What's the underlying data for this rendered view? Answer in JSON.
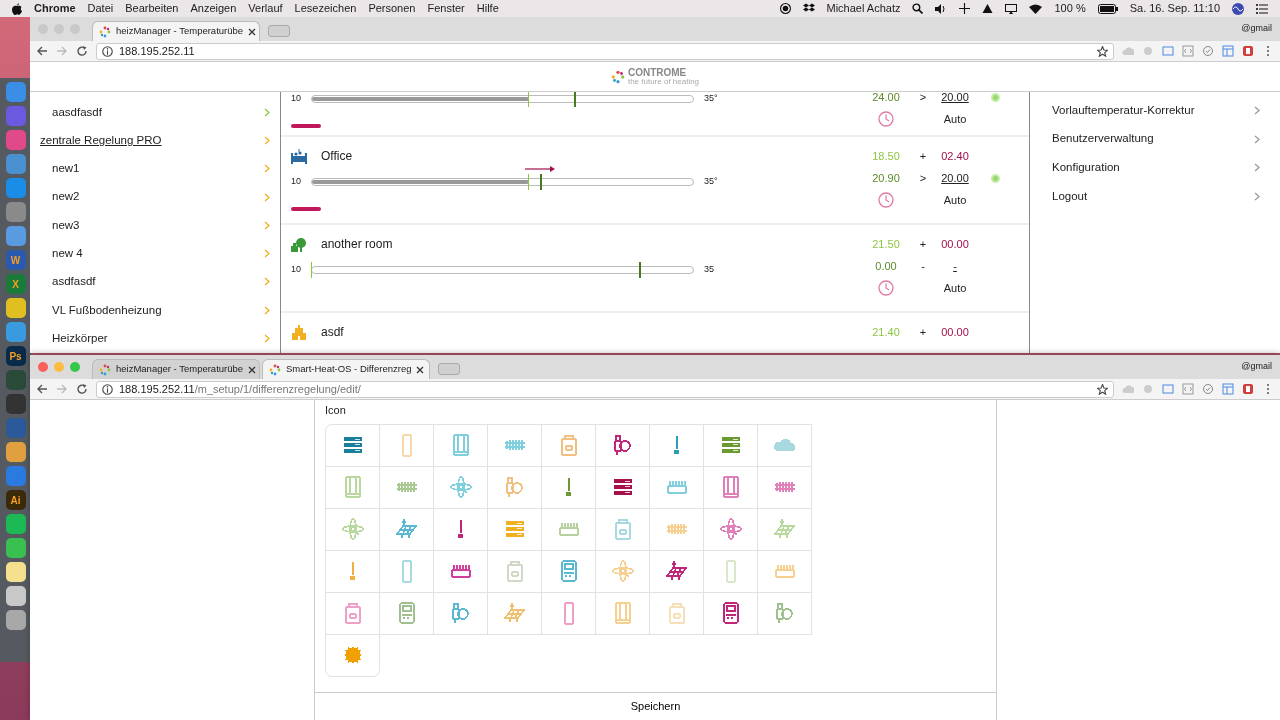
{
  "menubar": {
    "app": "Chrome",
    "menus": [
      "Datei",
      "Bearbeiten",
      "Anzeigen",
      "Verlauf",
      "Lesezeichen",
      "Personen",
      "Fenster",
      "Hilfe"
    ],
    "user": "Michael Achatz",
    "battery": "100 %",
    "clock": "Sa. 16. Sep. 11:10"
  },
  "dock": [
    {
      "color": "#3a8ee6"
    },
    {
      "color": "#6a5ae0"
    },
    {
      "color": "#e04a8a"
    },
    {
      "color": "#4a90d0"
    },
    {
      "color": "#1a8ee6"
    },
    {
      "color": "#8a8a8a"
    },
    {
      "color": "#5a9ae0"
    },
    {
      "color": "#2a5ab0",
      "label": "W"
    },
    {
      "color": "#1a7a3a",
      "label": "X"
    },
    {
      "color": "#e0c020"
    },
    {
      "color": "#3a9ae0"
    },
    {
      "color": "#0a2a4a",
      "label": "Ps"
    },
    {
      "color": "#2a4a3a"
    },
    {
      "color": "#333333"
    },
    {
      "color": "#2a5a9a"
    },
    {
      "color": "#e0a040"
    },
    {
      "color": "#2a7ae0"
    },
    {
      "color": "#3a2a0a",
      "label": "Ai"
    },
    {
      "color": "#1db954"
    },
    {
      "color": "#3ac050"
    },
    {
      "color": "#f5e090"
    },
    {
      "color": "#c8c8c8"
    },
    {
      "color": "#a8a8a8"
    }
  ],
  "window_top": {
    "focused": false,
    "tabs": [
      {
        "title": "heizManager - Temperaturübe",
        "selected": true
      }
    ],
    "profile": "@gmail",
    "url_host": "188.195.252.11",
    "logo": {
      "name": "CONTROME",
      "tagline": "the future of heating"
    },
    "sidebar": [
      {
        "kind": "item",
        "label": "aasdfasdf",
        "color": "#8dc63f"
      },
      {
        "kind": "group",
        "label": "zentrale Regelung PRO",
        "color": "#f0b020"
      },
      {
        "kind": "item",
        "label": "new1",
        "color": "#f0b020"
      },
      {
        "kind": "item",
        "label": "new2",
        "color": "#f0b020"
      },
      {
        "kind": "item",
        "label": "new3",
        "color": "#f0b020"
      },
      {
        "kind": "item",
        "label": "new 4",
        "color": "#f0b020"
      },
      {
        "kind": "item",
        "label": "asdfasdf",
        "color": "#f0b020"
      },
      {
        "kind": "item",
        "label": "VL Fußbodenheizung",
        "color": "#f0b020"
      },
      {
        "kind": "item",
        "label": "Heizkörper",
        "color": "#f0b020"
      }
    ],
    "rooms": [
      {
        "slider": {
          "min": "10",
          "max": "35°",
          "level": 0.57,
          "setpoint": {
            "level": 0.69
          }
        },
        "arrow": false,
        "heating_bar": true,
        "active": true,
        "values": [
          {
            "kind": "target",
            "actual": "24.00",
            "op": ">",
            "target": "20.00"
          }
        ],
        "mode": "Auto"
      },
      {
        "name": "Office",
        "slider": {
          "min": "10",
          "max": "35°",
          "level": 0.57,
          "setpoint": {
            "level": 0.6
          }
        },
        "arrow": true,
        "heating_bar": true,
        "active": true,
        "values": [
          {
            "kind": "offset",
            "actual": "18.50",
            "op": "+",
            "target": "02.40"
          },
          {
            "kind": "target",
            "actual": "20.90",
            "op": ">",
            "target": "20.00"
          }
        ],
        "mode": "Auto"
      },
      {
        "name": "another room",
        "slider": {
          "min": "10",
          "max": "35",
          "level": 0,
          "setpoint": {
            "level": 0.86
          }
        },
        "arrow": false,
        "heating_bar": false,
        "active": false,
        "values": [
          {
            "kind": "offset",
            "actual": "21.50",
            "op": "+",
            "target": "00.00"
          },
          {
            "kind": "target",
            "actual": "0.00",
            "op": "-",
            "target": "-"
          }
        ],
        "mode": "Auto"
      },
      {
        "name": "asdf",
        "arrow": false,
        "heating_bar": false,
        "active": false,
        "values": [
          {
            "kind": "offset",
            "actual": "21.40",
            "op": "+",
            "target": "00.00"
          }
        ]
      }
    ],
    "menu": [
      "Vorlauftemperatur-Korrektur",
      "Benutzerverwaltung",
      "Konfiguration",
      "Logout"
    ]
  },
  "window_bottom": {
    "focused": true,
    "tabs": [
      {
        "title": "heizManager - Temperaturübe",
        "selected": false
      },
      {
        "title": "Smart-Heat-OS - Differenzreg",
        "selected": true
      }
    ],
    "profile": "@gmail",
    "url_host": "188.195.252.11",
    "url_path": "/m_setup/1/differenzregelung/edit/",
    "field_label": "Icon",
    "icons": [
      {
        "kind": "server",
        "color": "#1a7f9a"
      },
      {
        "kind": "panel",
        "color": "#f5d9a8"
      },
      {
        "kind": "cabinet",
        "color": "#7fd0dc"
      },
      {
        "kind": "radiator",
        "color": "#7fd0dc"
      },
      {
        "kind": "boiler",
        "color": "#f0c080"
      },
      {
        "kind": "pump",
        "color": "#c0267a"
      },
      {
        "kind": "thermometer",
        "color": "#2aa0b8"
      },
      {
        "kind": "server",
        "color": "#6a9a30"
      },
      {
        "kind": "cloud",
        "color": "#a8d8e0"
      },
      {
        "kind": "cabinet",
        "color": "#b8d8a0"
      },
      {
        "kind": "radiator",
        "color": "#a8c890"
      },
      {
        "kind": "fan",
        "color": "#7fd0dc"
      },
      {
        "kind": "pump",
        "color": "#f0c080"
      },
      {
        "kind": "thermometer",
        "color": "#6a9a30"
      },
      {
        "kind": "server",
        "color": "#a8104a"
      },
      {
        "kind": "convector",
        "color": "#7fd0dc"
      },
      {
        "kind": "cabinet",
        "color": "#e080b8"
      },
      {
        "kind": "radiator",
        "color": "#e080b8"
      },
      {
        "kind": "fan",
        "color": "#b8d8a0"
      },
      {
        "kind": "solar",
        "color": "#5ab8d0"
      },
      {
        "kind": "thermometer",
        "color": "#c0267a"
      },
      {
        "kind": "server",
        "color": "#f0b020"
      },
      {
        "kind": "convector",
        "color": "#b8d0a0"
      },
      {
        "kind": "boiler",
        "color": "#a8d8e0"
      },
      {
        "kind": "radiator",
        "color": "#f5d090"
      },
      {
        "kind": "fan",
        "color": "#e080b8"
      },
      {
        "kind": "solar",
        "color": "#b8d8a0"
      },
      {
        "kind": "thermometer",
        "color": "#f0b040"
      },
      {
        "kind": "panel",
        "color": "#a8d8e0"
      },
      {
        "kind": "convector",
        "color": "#d0409a"
      },
      {
        "kind": "boiler",
        "color": "#d0d8c8"
      },
      {
        "kind": "controller",
        "color": "#5ab8d0"
      },
      {
        "kind": "fan",
        "color": "#f5d090"
      },
      {
        "kind": "solar",
        "color": "#c0267a"
      },
      {
        "kind": "panel",
        "color": "#d8e8c8"
      },
      {
        "kind": "convector",
        "color": "#f5d090"
      },
      {
        "kind": "boiler",
        "color": "#f0a0c8"
      },
      {
        "kind": "controller",
        "color": "#a0c090"
      },
      {
        "kind": "pump",
        "color": "#5ab8d0"
      },
      {
        "kind": "solar",
        "color": "#f0c070"
      },
      {
        "kind": "panel",
        "color": "#f0a0c8"
      },
      {
        "kind": "cabinet",
        "color": "#f5d090"
      },
      {
        "kind": "boiler",
        "color": "#f5e0b8"
      },
      {
        "kind": "controller",
        "color": "#c0267a"
      },
      {
        "kind": "pump",
        "color": "#a0c090"
      },
      {
        "kind": "sun",
        "color": "#f0a000"
      }
    ],
    "save": "Speichern"
  }
}
